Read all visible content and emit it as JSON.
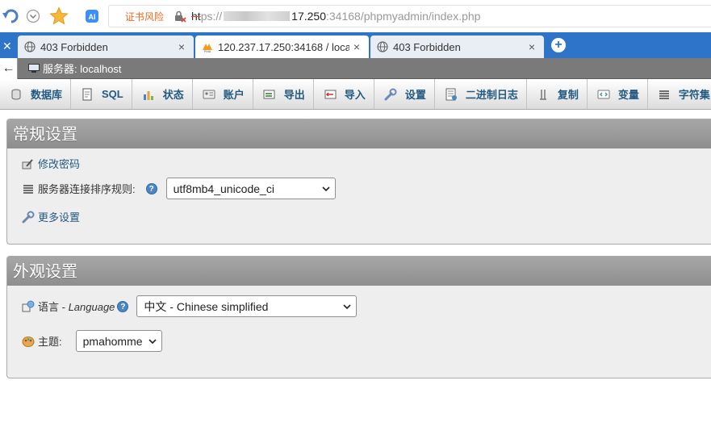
{
  "browser": {
    "cert_warning": "证书风险",
    "url_scheme": "ht",
    "url_scheme_rest": "ps://",
    "url_host": "17.250",
    "url_rest": ":34168/phpmyadmin/index.php",
    "tabs": [
      {
        "title": "403 Forbidden",
        "close": "×"
      },
      {
        "title": "120.237.17.250:34168 / loca",
        "close": "×"
      },
      {
        "title": "403 Forbidden",
        "close": "×"
      }
    ],
    "new_tab": "+"
  },
  "breadcrumb": {
    "back": "←",
    "label": "服务器: localhost"
  },
  "menu": [
    {
      "label": "数据库",
      "icon": "database-icon"
    },
    {
      "label": "SQL",
      "icon": "sql-icon"
    },
    {
      "label": "状态",
      "icon": "status-icon"
    },
    {
      "label": "账户",
      "icon": "accounts-icon"
    },
    {
      "label": "导出",
      "icon": "export-icon"
    },
    {
      "label": "导入",
      "icon": "import-icon"
    },
    {
      "label": "设置",
      "icon": "wrench-icon"
    },
    {
      "label": "二进制日志",
      "icon": "binlog-icon"
    },
    {
      "label": "复制",
      "icon": "replication-icon"
    },
    {
      "label": "变量",
      "icon": "variables-icon"
    },
    {
      "label": "字符集",
      "icon": "charset-icon"
    }
  ],
  "general": {
    "title": "常规设置",
    "change_password": "修改密码",
    "collation_label": "服务器连接排序规则:",
    "collation_value": "utf8mb4_unicode_ci",
    "more_settings": "更多设置"
  },
  "appearance": {
    "title": "外观设置",
    "language_label": "语言 - ",
    "language_label_en": "Language",
    "language_value": "中文 - Chinese simplified",
    "theme_label": "主题:",
    "theme_value": "pmahomme"
  },
  "help_glyph": "?"
}
